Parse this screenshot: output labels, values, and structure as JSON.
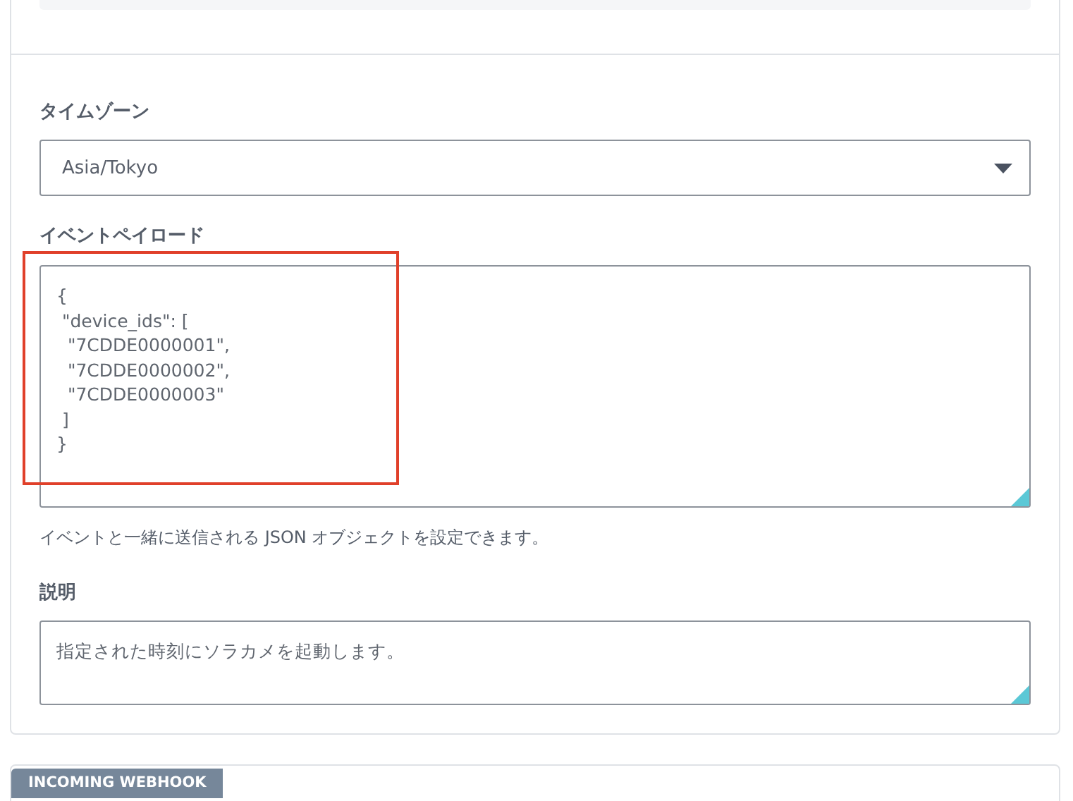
{
  "timezone": {
    "label": "タイムゾーン",
    "value": "Asia/Tokyo"
  },
  "payload": {
    "label": "イベントペイロード",
    "value": "{\n \"device_ids\": [\n  \"7CDDE0000001\",\n  \"7CDDE0000002\",\n  \"7CDDE0000003\"\n ]\n}",
    "highlighted": true,
    "help": "イベントと一緒に送信される JSON オブジェクトを設定できます。"
  },
  "description": {
    "label": "説明",
    "value": "指定された時刻にソラカメを起動します。"
  },
  "next_section": {
    "badge": "INCOMING WEBHOOK"
  }
}
